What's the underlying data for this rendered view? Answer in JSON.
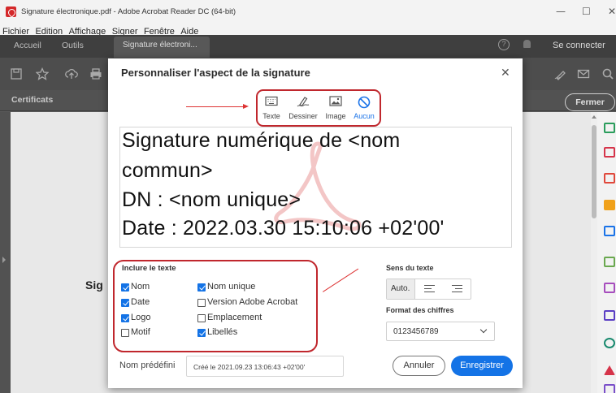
{
  "window": {
    "title": "Signature électronique.pdf - Adobe Acrobat Reader DC (64-bit)",
    "minimize": "—",
    "maximize": "☐",
    "close": "✕"
  },
  "menu": [
    "Fichier",
    "Edition",
    "Affichage",
    "Signer",
    "Fenêtre",
    "Aide"
  ],
  "tabs": {
    "home": "Accueil",
    "tools": "Outils",
    "document": "Signature électroni...",
    "document_close": "×",
    "signin": "Se connecter"
  },
  "secondary": {
    "certificates": "Certificats",
    "close": "Fermer"
  },
  "page": {
    "partial_text": "Sig"
  },
  "dialog": {
    "title": "Personnaliser l'aspect de la signature",
    "close": "✕",
    "modes": [
      {
        "label": "Texte",
        "icon": "keyboard-icon",
        "active": false
      },
      {
        "label": "Dessiner",
        "icon": "pen-icon",
        "active": false
      },
      {
        "label": "Image",
        "icon": "image-icon",
        "active": false
      },
      {
        "label": "Aucun",
        "icon": "none-icon",
        "active": true
      }
    ],
    "preview_lines": [
      "Signature numérique de <nom",
      "commun>",
      "DN : <nom unique>",
      "Date : 2022.03.30 15:10:06 +02'00'"
    ],
    "include": {
      "heading": "Inclure le texte",
      "nom": {
        "label": "Nom",
        "checked": true
      },
      "date": {
        "label": "Date",
        "checked": true
      },
      "logo": {
        "label": "Logo",
        "checked": true
      },
      "motif": {
        "label": "Motif",
        "checked": false
      },
      "nom_unique": {
        "label": "Nom unique",
        "checked": true
      },
      "version": {
        "label": "Version Adobe Acrobat",
        "checked": false
      },
      "emplacement": {
        "label": "Emplacement",
        "checked": false
      },
      "libelles": {
        "label": "Libellés",
        "checked": true
      }
    },
    "direction": {
      "heading": "Sens du texte",
      "auto": "Auto."
    },
    "number_format": {
      "heading": "Format des chiffres",
      "value": "0123456789"
    },
    "preset": {
      "label": "Nom prédéfini",
      "value": "Créé le 2021.09.23 13:06:43 +02'00'"
    },
    "cancel": "Annuler",
    "save": "Enregistrer"
  },
  "colors": {
    "accent": "#1473e6",
    "highlight": "#c0272d"
  }
}
